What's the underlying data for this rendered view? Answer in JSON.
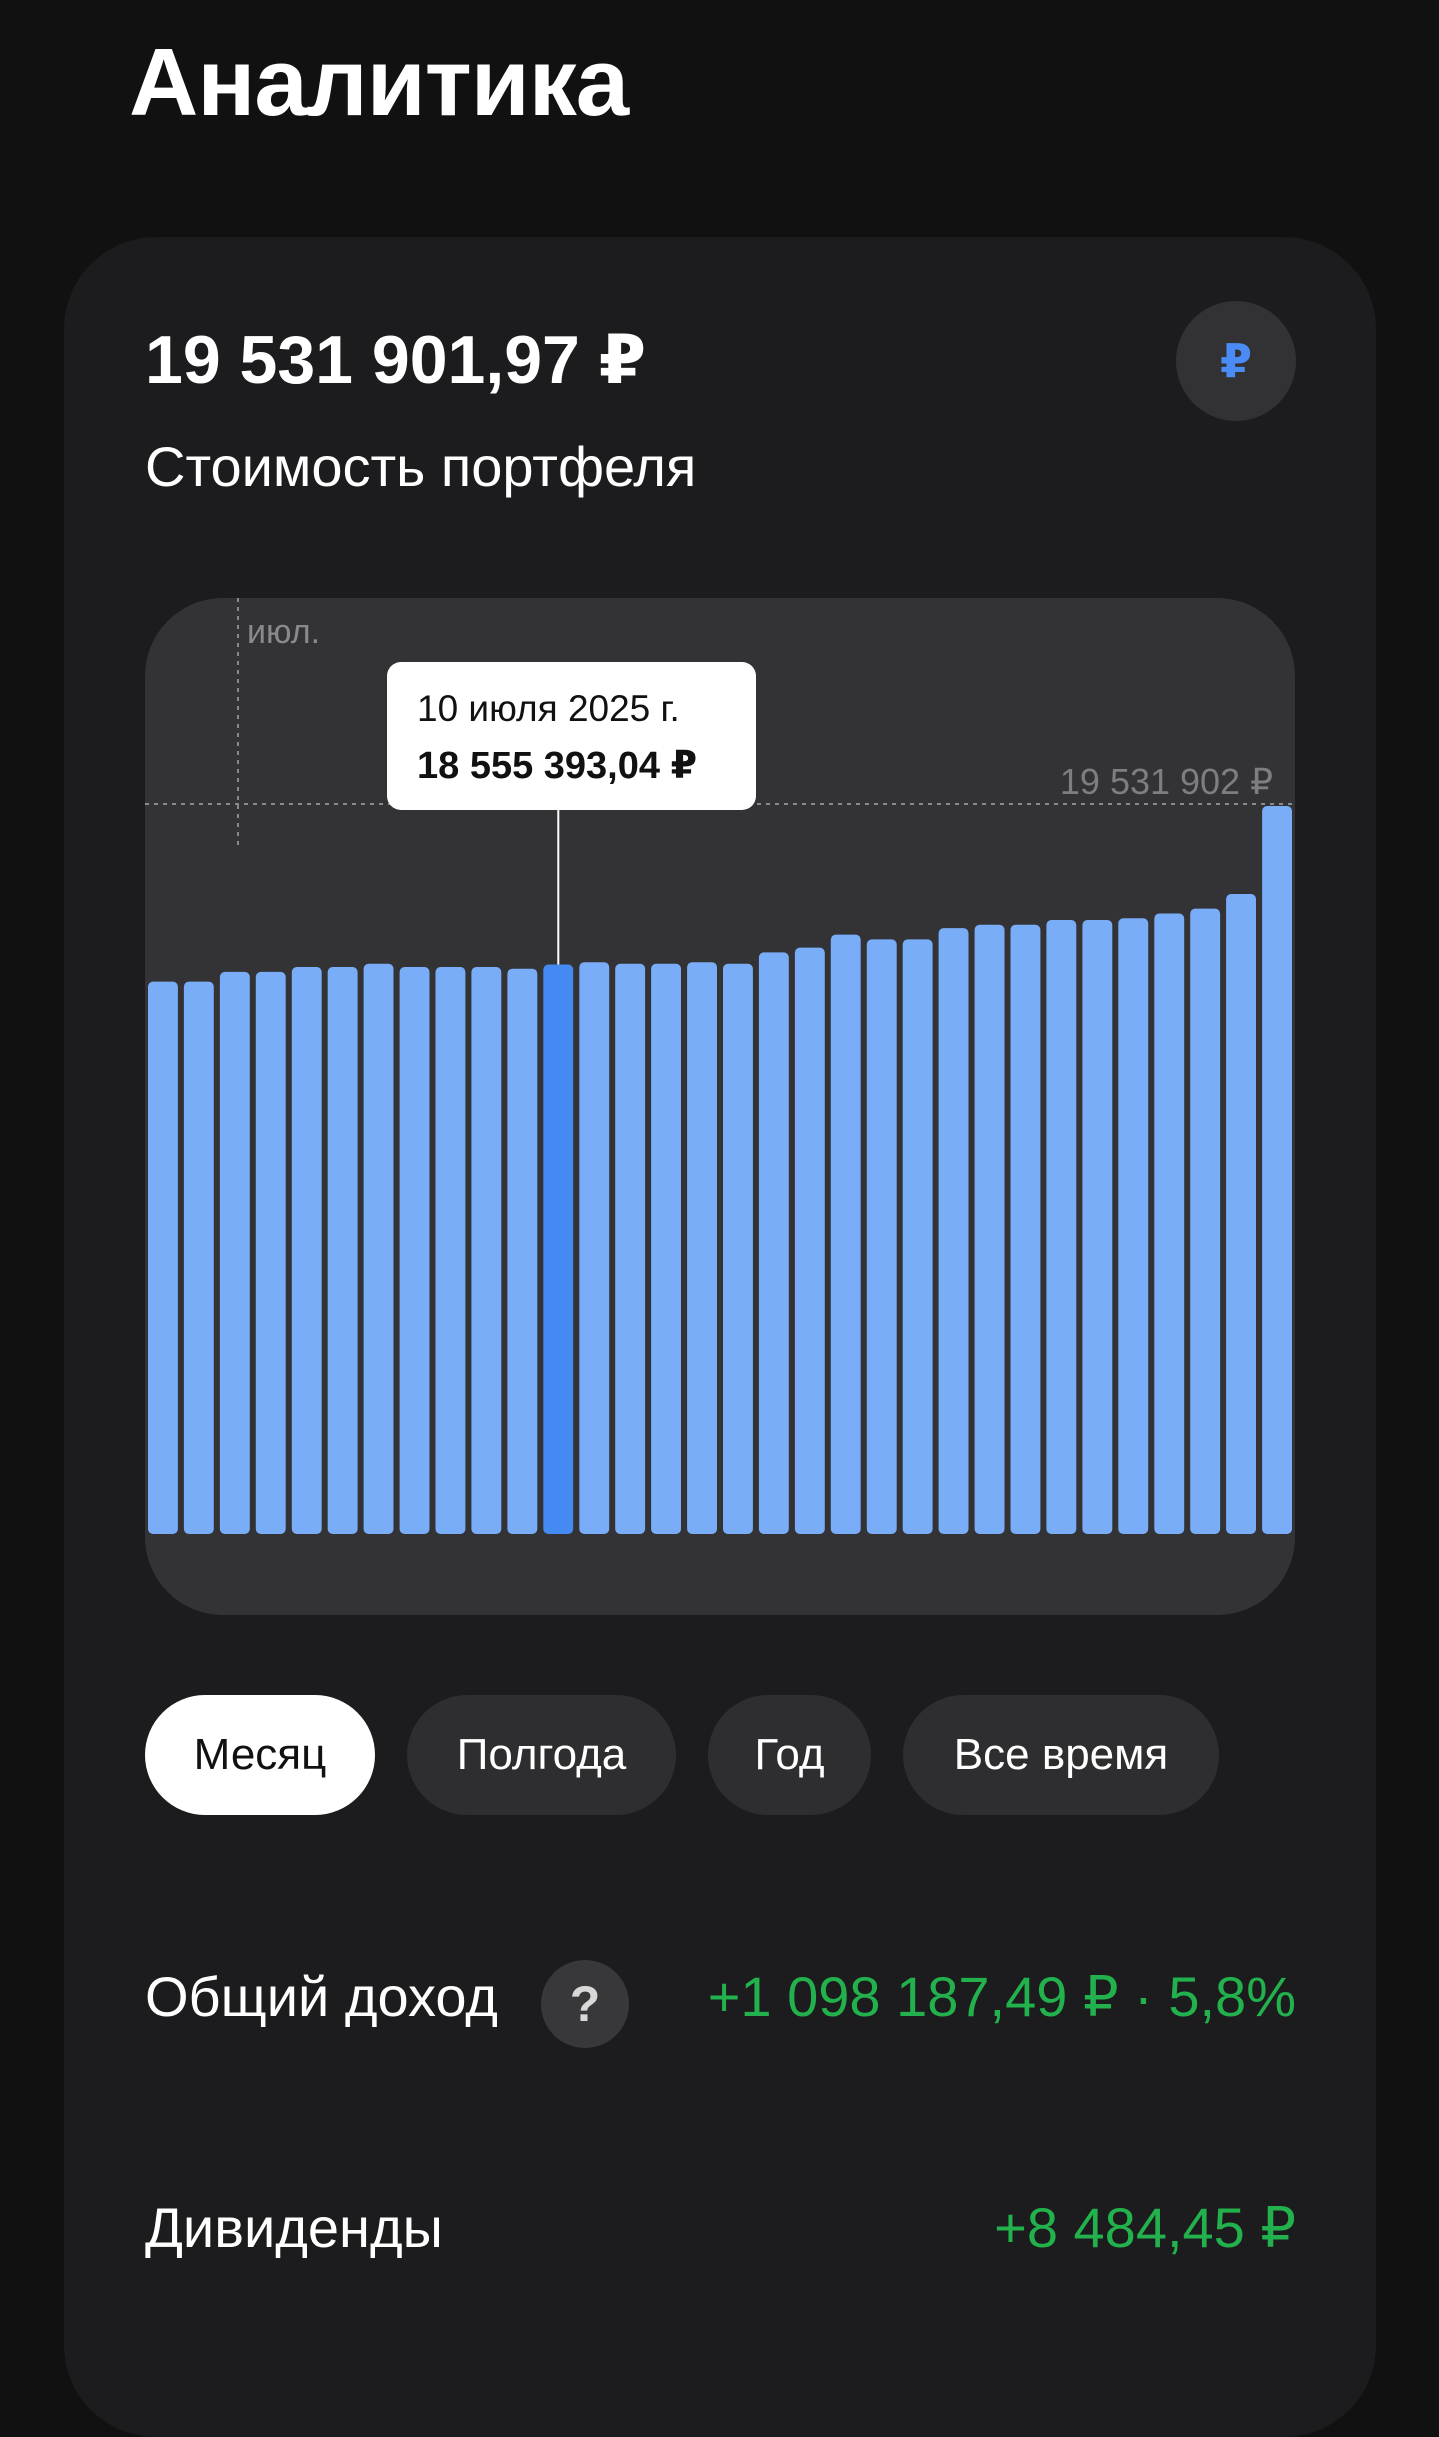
{
  "page": {
    "title": "Аналитика"
  },
  "portfolio": {
    "total_value": "19 531 901,97 ₽",
    "total_label": "Стоимость портфеля",
    "currency_symbol": "₽"
  },
  "chart_data": {
    "type": "bar",
    "month_label": "июл.",
    "max_label": "19 531 902 ₽",
    "ylim": [
      0,
      19531902
    ],
    "values": [
      18450000,
      18450000,
      18510000,
      18510000,
      18540000,
      18540000,
      18560000,
      18540000,
      18540000,
      18540000,
      18530000,
      18555393.04,
      18570000,
      18560000,
      18560000,
      18570000,
      18560000,
      18630000,
      18660000,
      18740000,
      18710000,
      18710000,
      18780000,
      18800000,
      18800000,
      18830000,
      18830000,
      18840000,
      18870000,
      18900000,
      18990000,
      19531901.97
    ],
    "selected_index": 11,
    "tooltip": {
      "date": "10 июля 2025 г.",
      "value": "18 555 393,04 ₽"
    },
    "colors": {
      "bar": "#7aadf8",
      "selected_bar": "#4589f3",
      "background": "#333335"
    }
  },
  "periods": [
    "Месяц",
    "Полгода",
    "Год",
    "Все время"
  ],
  "active_period": "Месяц",
  "stats": {
    "income_label": "Общий доход",
    "income_value": "+1 098 187,49 ₽ · 5,8%",
    "dividends_label": "Дивиденды",
    "dividends_value": "+8 484,45 ₽"
  },
  "colors": {
    "accent": "#4a8bf5",
    "positive": "#22b14c"
  }
}
